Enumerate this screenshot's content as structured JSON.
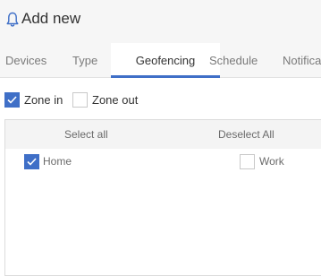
{
  "header": {
    "icon": "bell-icon",
    "title": "Add new"
  },
  "tabs": [
    {
      "label": "Devices",
      "active": false
    },
    {
      "label": "Type",
      "active": false
    },
    {
      "label": "Geofencing",
      "active": true
    },
    {
      "label": "Schedule",
      "active": false
    },
    {
      "label": "Notifica",
      "active": false
    }
  ],
  "zone": {
    "zone_in": {
      "label": "Zone in",
      "checked": true
    },
    "zone_out": {
      "label": "Zone out",
      "checked": false
    }
  },
  "selection": {
    "select_all_label": "Select all",
    "deselect_all_label": "Deselect All"
  },
  "items": [
    {
      "label": "Home",
      "checked": true
    },
    {
      "label": "Work",
      "checked": false
    }
  ],
  "colors": {
    "accent": "#3f6fc7",
    "header_bg": "#f6f6f6"
  }
}
